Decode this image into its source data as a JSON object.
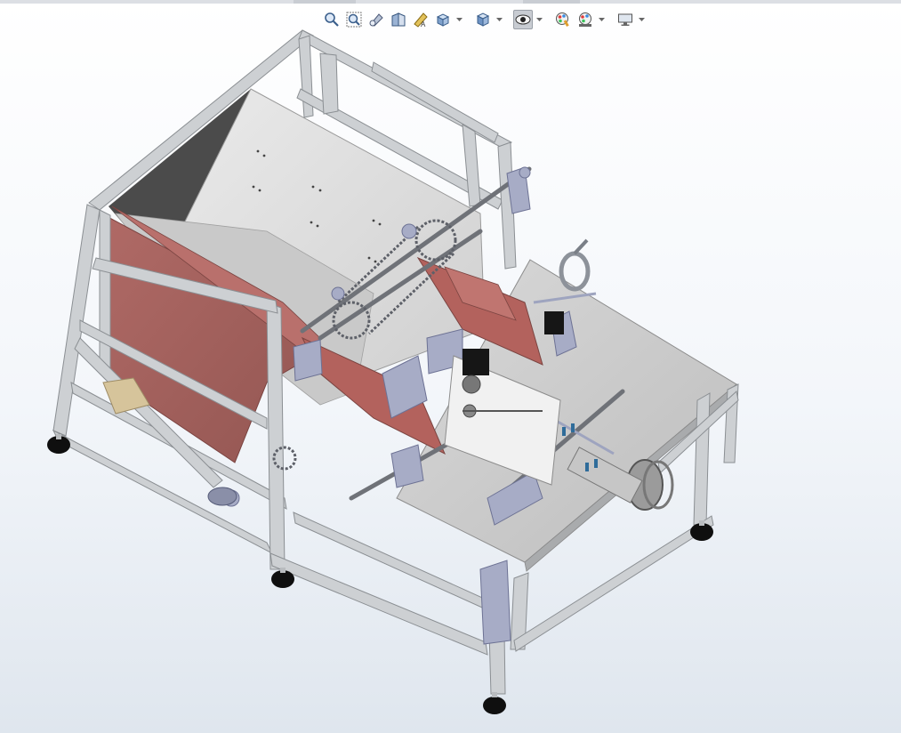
{
  "window": {
    "background_top": "#ffffff",
    "background_bottom": "#dfe6ee"
  },
  "heads_up_toolbar": {
    "items": [
      {
        "icon": "zoom-to-fit-icon",
        "has_dropdown": false,
        "active": false
      },
      {
        "icon": "zoom-to-area-icon",
        "has_dropdown": false,
        "active": false
      },
      {
        "icon": "previous-view-icon",
        "has_dropdown": false,
        "active": false
      },
      {
        "icon": "section-view-icon",
        "has_dropdown": false,
        "active": false
      },
      {
        "icon": "dynamic-annotation-icon",
        "has_dropdown": false,
        "active": false
      },
      {
        "icon": "view-orientation-icon",
        "has_dropdown": true,
        "active": false
      },
      {
        "icon": "display-style-icon",
        "has_dropdown": true,
        "active": false
      },
      {
        "icon": "hide-show-items-icon",
        "has_dropdown": true,
        "active": true
      },
      {
        "icon": "edit-appearance-icon",
        "has_dropdown": false,
        "active": false
      },
      {
        "icon": "apply-scene-icon",
        "has_dropdown": true,
        "active": false
      },
      {
        "icon": "view-settings-icon",
        "has_dropdown": true,
        "active": false
      }
    ]
  },
  "model": {
    "frame_color": "#c8cbce",
    "panel_color": "#a8625e",
    "sheet_color": "#dedede",
    "bracket_color": "#9ea4bf",
    "foot_color": "#111111"
  }
}
